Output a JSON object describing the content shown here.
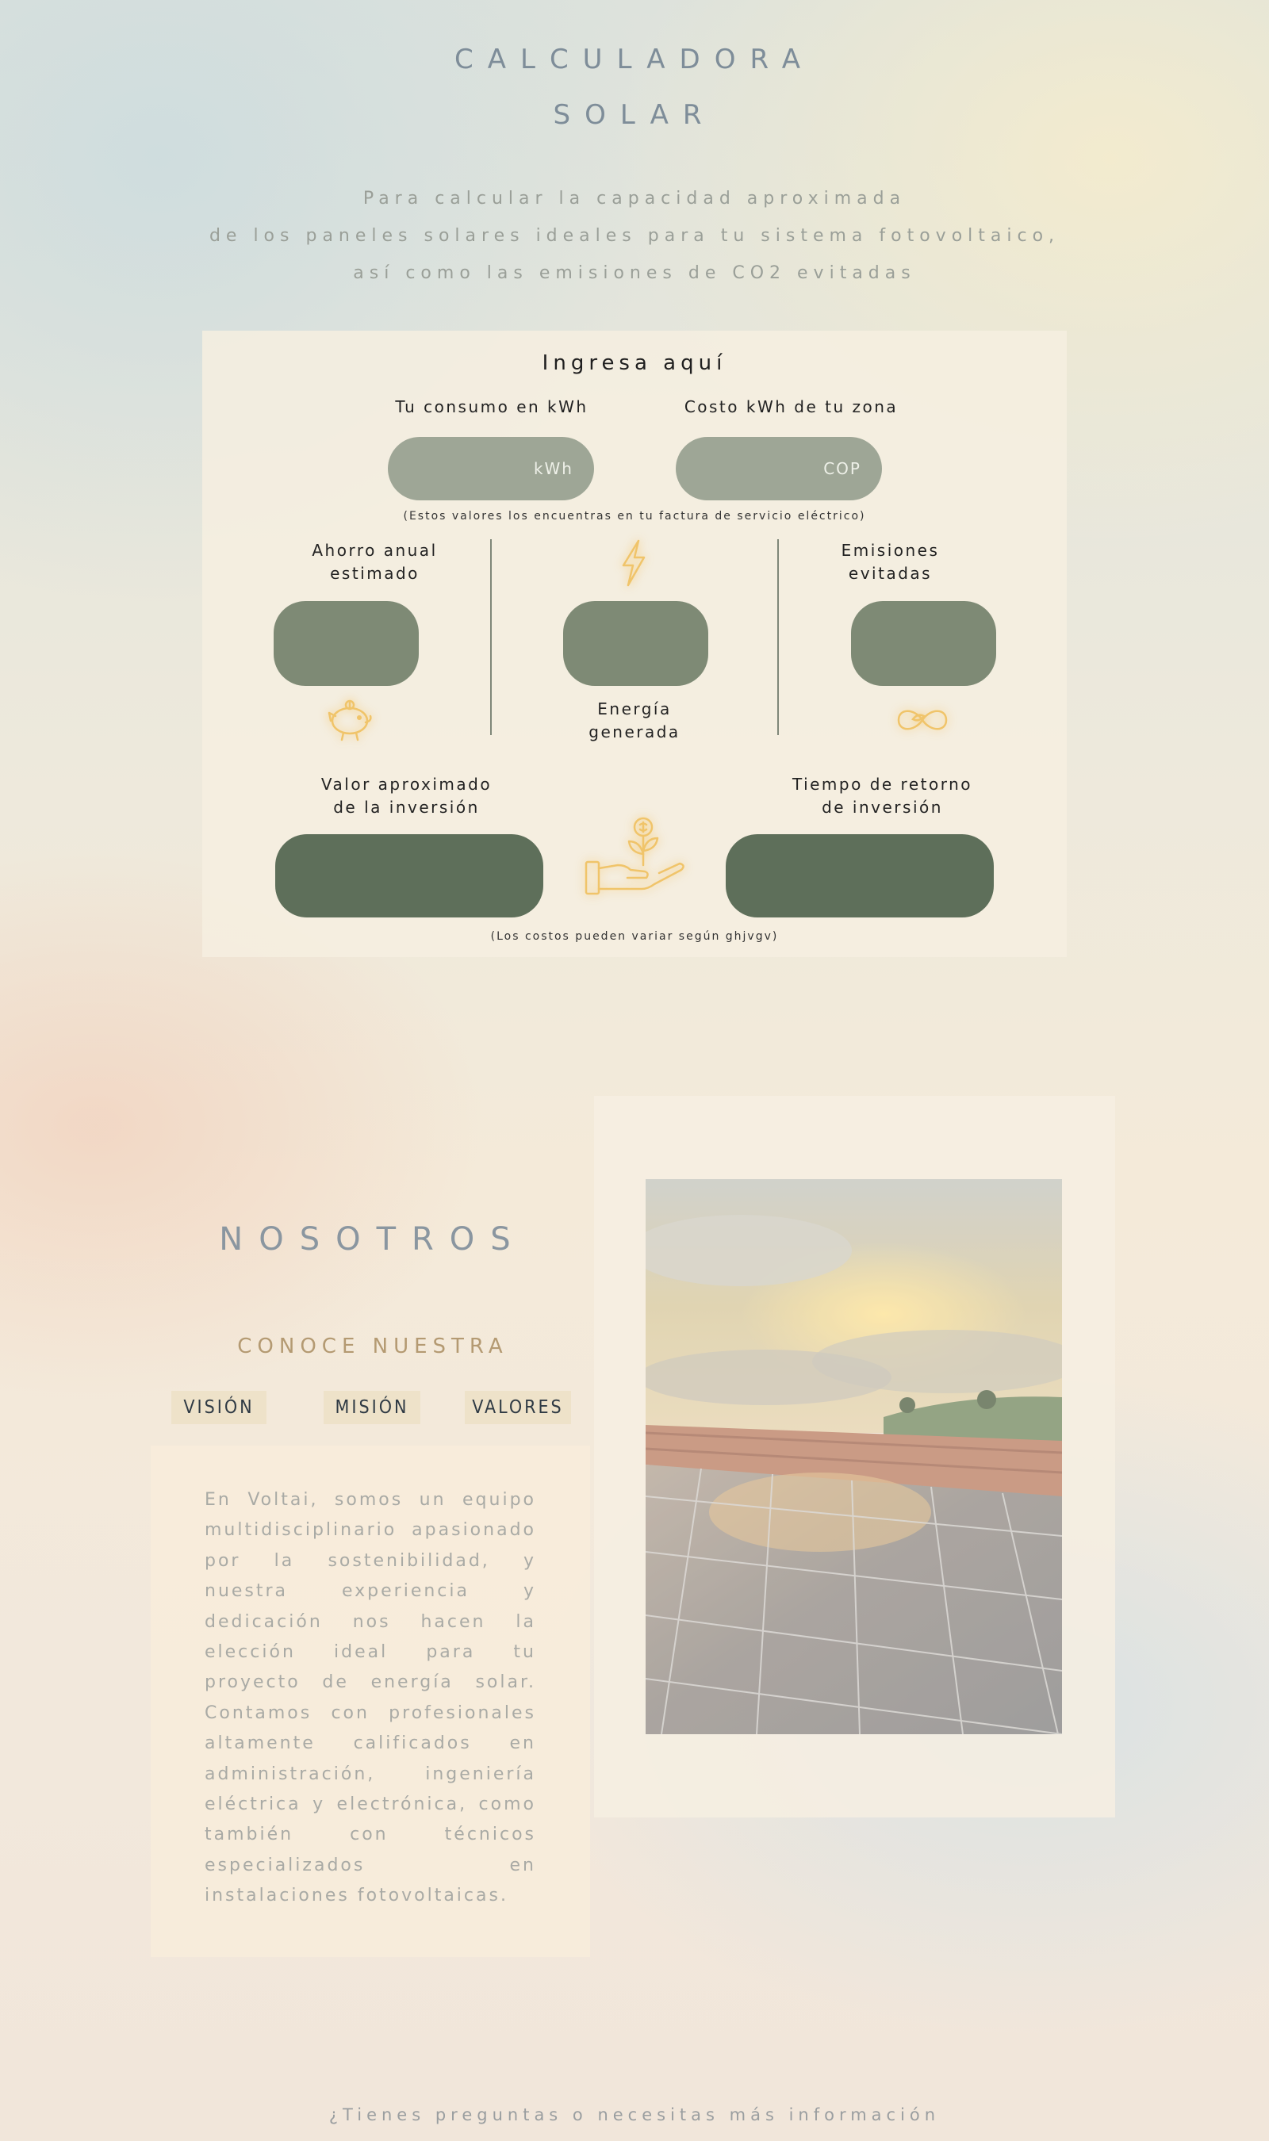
{
  "header": {
    "title_line1": "CALCULADORA",
    "title_line2": "SOLAR",
    "intro_line1": "Para calcular la capacidad aproximada",
    "intro_line2": "de los paneles solares ideales para tu sistema fotovoltaico,",
    "intro_line3": "así como las emisiones de CO2 evitadas"
  },
  "calculator": {
    "title": "Ingresa aquí",
    "consumo_label": "Tu consumo en kWh",
    "consumo_placeholder": "kWh",
    "costo_label": "Costo kWh de tu zona",
    "costo_placeholder": "COP",
    "inputs_note": "(Estos valores los encuentras en tu factura de servicio eléctrico)",
    "ahorro_label_1": "Ahorro anual",
    "ahorro_label_2": "estimado",
    "energia_label_1": "Energía",
    "energia_label_2": "generada",
    "emisiones_label_1": "Emisiones",
    "emisiones_label_2": "evitadas",
    "valor_label_1": "Valor aproximado",
    "valor_label_2": "de la inversión",
    "tiempo_label_1": "Tiempo de retorno",
    "tiempo_label_2": "de inversión",
    "costs_note": "(Los costos pueden variar según ghjvgv)",
    "icons": [
      "piggy-bank-icon",
      "lightning-icon",
      "infinity-leaf-icon",
      "hand-plant-coin-icon"
    ],
    "icon_color": "#f0c46a"
  },
  "about": {
    "title": "NOSOTROS",
    "subtitle": "CONOCE NUESTRA",
    "tabs": [
      "VISIÓN",
      "MISIÓN",
      "VALORES"
    ],
    "paragraph": "En Voltai, somos un equipo multidisciplinario apasionado por la sostenibilidad, y nuestra experiencia y dedicación nos hacen la elección ideal para tu proyecto de energía solar. Contamos con profesionales altamente calificados en administración, ingeniería eléctrica y electrónica, como también con técnicos especializados en instalaciones fotovoltaicas."
  },
  "footer": {
    "text": "¿Tienes preguntas o necesitas más información"
  },
  "colors": {
    "input_pill": "#9ea696",
    "result_pill": "#7e8a75",
    "investment_pill": "#5e6f5a",
    "accent_gold": "#b49a72"
  }
}
